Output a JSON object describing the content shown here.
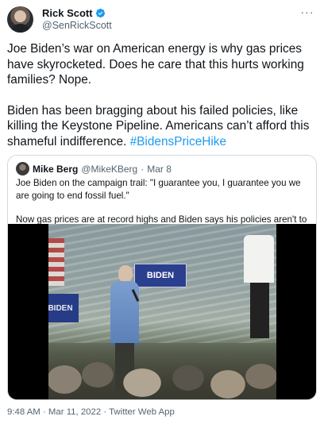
{
  "author": {
    "display_name": "Rick Scott",
    "handle": "@SenRickScott",
    "verified": true
  },
  "more_menu_glyph": "···",
  "tweet": {
    "paragraph_1": "Joe Biden’s war on American energy is why gas prices have skyrocketed. Does he care that this hurts working families? Nope.",
    "paragraph_2_text": "Biden has been bragging about his failed policies, like killing the Keystone Pipeline. Americans can’t afford this shameful indifference. ",
    "hashtag": "#BidensPriceHike"
  },
  "quoted_tweet": {
    "display_name": "Mike Berg",
    "handle": "@MikeKBerg",
    "separator": "·",
    "date": "Mar 8",
    "paragraph_1": "Joe Biden on the campaign trail: \"I guarantee you, I guarantee you we are going to end fossil fuel.\"",
    "paragraph_2": "Now gas prices are at record highs and Biden says his policies aren't to blame?",
    "video": {
      "sign_main_text": "BIDEN",
      "sign_left_text": "BIDEN"
    }
  },
  "footer": {
    "text": "9:48 AM · Mar 11, 2022 · Twitter Web App"
  },
  "colors": {
    "link": "#1d9bf0",
    "secondary_text": "#536471",
    "primary_text": "#0f1419",
    "border": "#cfd9de"
  }
}
